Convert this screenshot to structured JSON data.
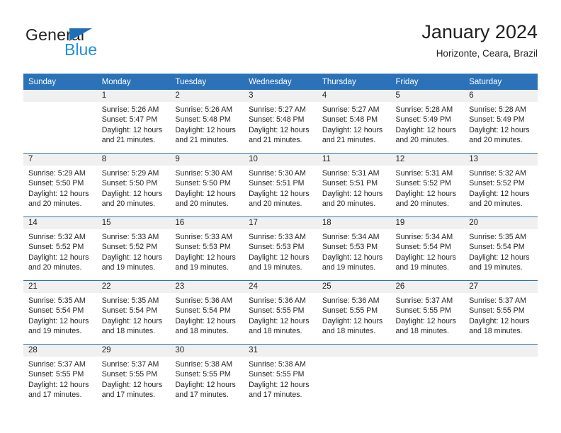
{
  "brand": {
    "word_one": "General",
    "word_two": "Blue",
    "triangle_color": "#1f6fb6",
    "blue_color": "#1f8fdb"
  },
  "header": {
    "title": "January 2024",
    "subtitle": "Horizonte, Ceara, Brazil",
    "header_bg": "#2b72b8",
    "daynum_bg": "#f0f0f0"
  },
  "weekdays": [
    "Sunday",
    "Monday",
    "Tuesday",
    "Wednesday",
    "Thursday",
    "Friday",
    "Saturday"
  ],
  "weeks": [
    [
      {
        "day": "",
        "sunrise": "",
        "sunset": "",
        "daylight": ""
      },
      {
        "day": "1",
        "sunrise": "Sunrise: 5:26 AM",
        "sunset": "Sunset: 5:47 PM",
        "daylight": "Daylight: 12 hours and 21 minutes."
      },
      {
        "day": "2",
        "sunrise": "Sunrise: 5:26 AM",
        "sunset": "Sunset: 5:48 PM",
        "daylight": "Daylight: 12 hours and 21 minutes."
      },
      {
        "day": "3",
        "sunrise": "Sunrise: 5:27 AM",
        "sunset": "Sunset: 5:48 PM",
        "daylight": "Daylight: 12 hours and 21 minutes."
      },
      {
        "day": "4",
        "sunrise": "Sunrise: 5:27 AM",
        "sunset": "Sunset: 5:48 PM",
        "daylight": "Daylight: 12 hours and 21 minutes."
      },
      {
        "day": "5",
        "sunrise": "Sunrise: 5:28 AM",
        "sunset": "Sunset: 5:49 PM",
        "daylight": "Daylight: 12 hours and 20 minutes."
      },
      {
        "day": "6",
        "sunrise": "Sunrise: 5:28 AM",
        "sunset": "Sunset: 5:49 PM",
        "daylight": "Daylight: 12 hours and 20 minutes."
      }
    ],
    [
      {
        "day": "7",
        "sunrise": "Sunrise: 5:29 AM",
        "sunset": "Sunset: 5:50 PM",
        "daylight": "Daylight: 12 hours and 20 minutes."
      },
      {
        "day": "8",
        "sunrise": "Sunrise: 5:29 AM",
        "sunset": "Sunset: 5:50 PM",
        "daylight": "Daylight: 12 hours and 20 minutes."
      },
      {
        "day": "9",
        "sunrise": "Sunrise: 5:30 AM",
        "sunset": "Sunset: 5:50 PM",
        "daylight": "Daylight: 12 hours and 20 minutes."
      },
      {
        "day": "10",
        "sunrise": "Sunrise: 5:30 AM",
        "sunset": "Sunset: 5:51 PM",
        "daylight": "Daylight: 12 hours and 20 minutes."
      },
      {
        "day": "11",
        "sunrise": "Sunrise: 5:31 AM",
        "sunset": "Sunset: 5:51 PM",
        "daylight": "Daylight: 12 hours and 20 minutes."
      },
      {
        "day": "12",
        "sunrise": "Sunrise: 5:31 AM",
        "sunset": "Sunset: 5:52 PM",
        "daylight": "Daylight: 12 hours and 20 minutes."
      },
      {
        "day": "13",
        "sunrise": "Sunrise: 5:32 AM",
        "sunset": "Sunset: 5:52 PM",
        "daylight": "Daylight: 12 hours and 20 minutes."
      }
    ],
    [
      {
        "day": "14",
        "sunrise": "Sunrise: 5:32 AM",
        "sunset": "Sunset: 5:52 PM",
        "daylight": "Daylight: 12 hours and 20 minutes."
      },
      {
        "day": "15",
        "sunrise": "Sunrise: 5:33 AM",
        "sunset": "Sunset: 5:52 PM",
        "daylight": "Daylight: 12 hours and 19 minutes."
      },
      {
        "day": "16",
        "sunrise": "Sunrise: 5:33 AM",
        "sunset": "Sunset: 5:53 PM",
        "daylight": "Daylight: 12 hours and 19 minutes."
      },
      {
        "day": "17",
        "sunrise": "Sunrise: 5:33 AM",
        "sunset": "Sunset: 5:53 PM",
        "daylight": "Daylight: 12 hours and 19 minutes."
      },
      {
        "day": "18",
        "sunrise": "Sunrise: 5:34 AM",
        "sunset": "Sunset: 5:53 PM",
        "daylight": "Daylight: 12 hours and 19 minutes."
      },
      {
        "day": "19",
        "sunrise": "Sunrise: 5:34 AM",
        "sunset": "Sunset: 5:54 PM",
        "daylight": "Daylight: 12 hours and 19 minutes."
      },
      {
        "day": "20",
        "sunrise": "Sunrise: 5:35 AM",
        "sunset": "Sunset: 5:54 PM",
        "daylight": "Daylight: 12 hours and 19 minutes."
      }
    ],
    [
      {
        "day": "21",
        "sunrise": "Sunrise: 5:35 AM",
        "sunset": "Sunset: 5:54 PM",
        "daylight": "Daylight: 12 hours and 19 minutes."
      },
      {
        "day": "22",
        "sunrise": "Sunrise: 5:35 AM",
        "sunset": "Sunset: 5:54 PM",
        "daylight": "Daylight: 12 hours and 18 minutes."
      },
      {
        "day": "23",
        "sunrise": "Sunrise: 5:36 AM",
        "sunset": "Sunset: 5:54 PM",
        "daylight": "Daylight: 12 hours and 18 minutes."
      },
      {
        "day": "24",
        "sunrise": "Sunrise: 5:36 AM",
        "sunset": "Sunset: 5:55 PM",
        "daylight": "Daylight: 12 hours and 18 minutes."
      },
      {
        "day": "25",
        "sunrise": "Sunrise: 5:36 AM",
        "sunset": "Sunset: 5:55 PM",
        "daylight": "Daylight: 12 hours and 18 minutes."
      },
      {
        "day": "26",
        "sunrise": "Sunrise: 5:37 AM",
        "sunset": "Sunset: 5:55 PM",
        "daylight": "Daylight: 12 hours and 18 minutes."
      },
      {
        "day": "27",
        "sunrise": "Sunrise: 5:37 AM",
        "sunset": "Sunset: 5:55 PM",
        "daylight": "Daylight: 12 hours and 18 minutes."
      }
    ],
    [
      {
        "day": "28",
        "sunrise": "Sunrise: 5:37 AM",
        "sunset": "Sunset: 5:55 PM",
        "daylight": "Daylight: 12 hours and 17 minutes."
      },
      {
        "day": "29",
        "sunrise": "Sunrise: 5:37 AM",
        "sunset": "Sunset: 5:55 PM",
        "daylight": "Daylight: 12 hours and 17 minutes."
      },
      {
        "day": "30",
        "sunrise": "Sunrise: 5:38 AM",
        "sunset": "Sunset: 5:55 PM",
        "daylight": "Daylight: 12 hours and 17 minutes."
      },
      {
        "day": "31",
        "sunrise": "Sunrise: 5:38 AM",
        "sunset": "Sunset: 5:55 PM",
        "daylight": "Daylight: 12 hours and 17 minutes."
      },
      {
        "day": "",
        "sunrise": "",
        "sunset": "",
        "daylight": ""
      },
      {
        "day": "",
        "sunrise": "",
        "sunset": "",
        "daylight": ""
      },
      {
        "day": "",
        "sunrise": "",
        "sunset": "",
        "daylight": ""
      }
    ]
  ]
}
